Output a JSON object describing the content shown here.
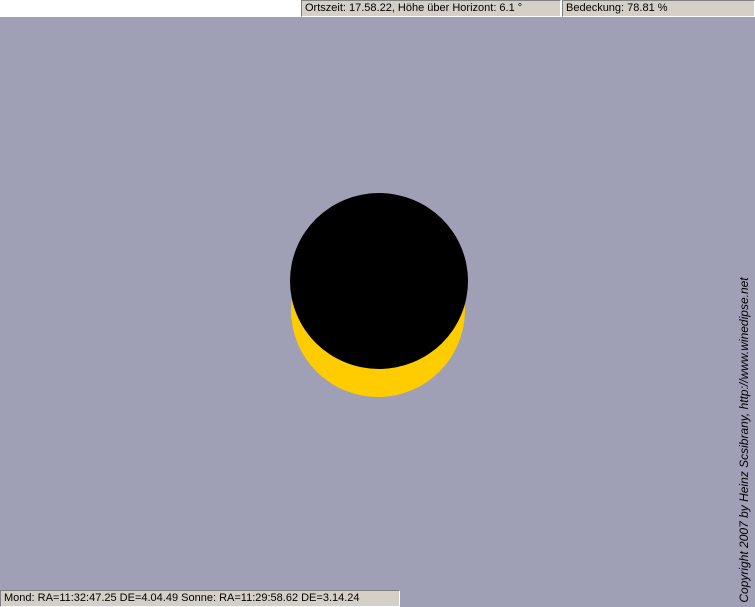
{
  "top_status": {
    "local_time_text": "Ortszeit: 17.58.22, Höhe über Horizont:    6.1 °",
    "coverage_text": "Bedeckung: 78.81 %"
  },
  "bottom_status": {
    "coordinates_text": "Mond: RA=11:32:47.25 DE=4.04.49  Sonne: RA=11:29:58.62 DE=3.14.24"
  },
  "watermark": {
    "copyright_text": "Copyright 2007 by Heinz Scsibrany,  http://www.winedipse.net"
  },
  "colors": {
    "sky": "#9f9fb6",
    "sun": "#ffcc00",
    "moon": "#000000"
  }
}
